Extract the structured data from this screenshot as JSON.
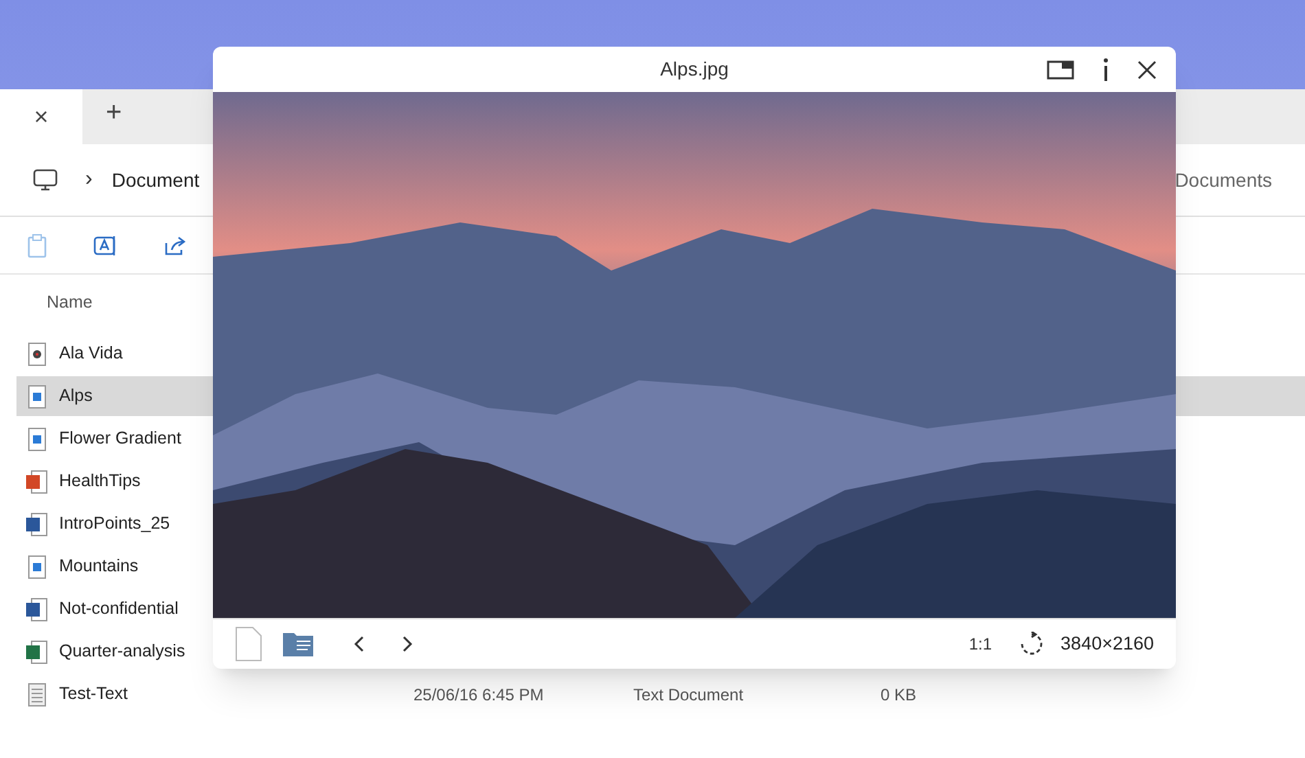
{
  "explorer": {
    "tab": {
      "close": "×",
      "new": "+"
    },
    "breadcrumb": {
      "separator": "›",
      "folder": "Document"
    },
    "search": {
      "placeholder": "Documents"
    },
    "columns": {
      "name": "Name"
    },
    "rows": [
      {
        "name": "Ala Vida",
        "kind": "video",
        "selected": false
      },
      {
        "name": "Alps",
        "kind": "image",
        "selected": true
      },
      {
        "name": "Flower Gradient",
        "kind": "image",
        "selected": false
      },
      {
        "name": "HealthTips",
        "kind": "powerpoint",
        "selected": false
      },
      {
        "name": "IntroPoints_25",
        "kind": "word",
        "selected": false
      },
      {
        "name": "Mountains",
        "kind": "image",
        "selected": false
      },
      {
        "name": "Not-confidential",
        "kind": "word",
        "selected": false
      },
      {
        "name": "Quarter-analysis",
        "kind": "excel",
        "selected": false
      },
      {
        "name": "Test-Text",
        "kind": "text",
        "selected": false,
        "date": "25/06/16 6:45 PM",
        "type": "Text Document",
        "size": "0 KB"
      }
    ]
  },
  "viewer": {
    "title": "Alps.jpg",
    "zoom": "1:1",
    "dimensions": "3840×2160"
  }
}
